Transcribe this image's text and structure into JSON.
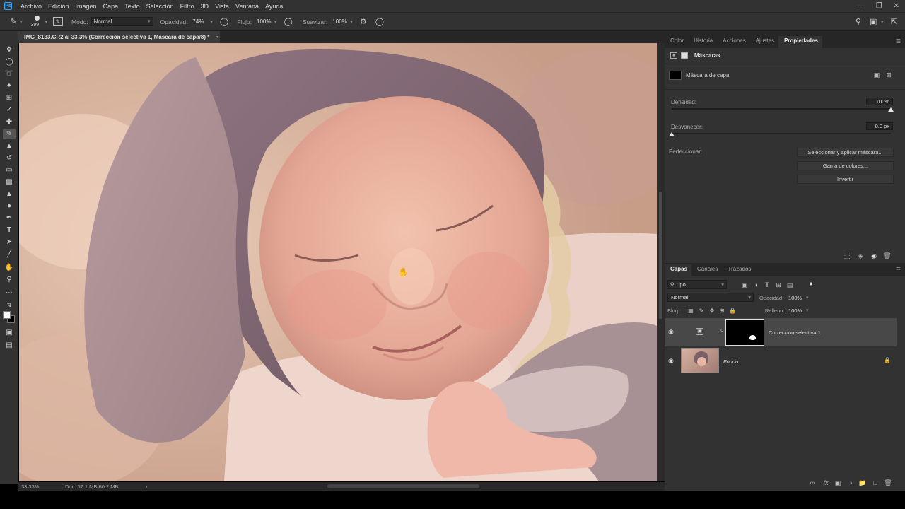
{
  "app": {
    "logo": "Ps"
  },
  "menu": [
    "Archivo",
    "Edición",
    "Imagen",
    "Capa",
    "Texto",
    "Selección",
    "Filtro",
    "3D",
    "Vista",
    "Ventana",
    "Ayuda"
  ],
  "options": {
    "brush_size": "399",
    "mode_label": "Modo:",
    "mode_value": "Normal",
    "opacity_label": "Opacidad:",
    "opacity_value": "74%",
    "flow_label": "Flujo:",
    "flow_value": "100%",
    "smooth_label": "Suavizar:",
    "smooth_value": "100%"
  },
  "document": {
    "tab_title": "IMG_8133.CR2 al 33.3% (Corrección selectiva 1, Máscara de capa/8) *",
    "close": "×"
  },
  "status": {
    "zoom": "33.33%",
    "doc": "Doc: 57.1 MB/60.2 MB",
    "arrow": "›"
  },
  "properties_panel": {
    "tabs": [
      "Color",
      "Historia",
      "Acciones",
      "Ajustes",
      "Propiedades"
    ],
    "active_tab": "Propiedades",
    "section_title": "Máscaras",
    "mask_type": "Máscara de capa",
    "density_label": "Densidad:",
    "density_value": "100%",
    "density_fraction": 1.0,
    "feather_label": "Desvanecer:",
    "feather_value": "0.0 px",
    "feather_fraction": 0.0,
    "refine_label": "Perfeccionar:",
    "btn_select_mask": "Seleccionar y aplicar máscara...",
    "btn_color_range": "Gama de colores...",
    "btn_invert": "Invertir"
  },
  "layers_panel": {
    "tabs": [
      "Capas",
      "Canales",
      "Trazados"
    ],
    "active_tab": "Capas",
    "filter_value": "Tipo",
    "blend_mode": "Normal",
    "opacity_label": "Opacidad:",
    "opacity_value": "100%",
    "lock_label": "Bloq.:",
    "fill_label": "Relleno:",
    "fill_value": "100%",
    "layers": [
      {
        "name": "Corrección selectiva 1",
        "selected": true
      },
      {
        "name": "Fondo",
        "selected": false
      }
    ]
  },
  "colors": {
    "accent": "#31a8ff",
    "panel_bg": "#323232",
    "dark_bg": "#262626"
  }
}
